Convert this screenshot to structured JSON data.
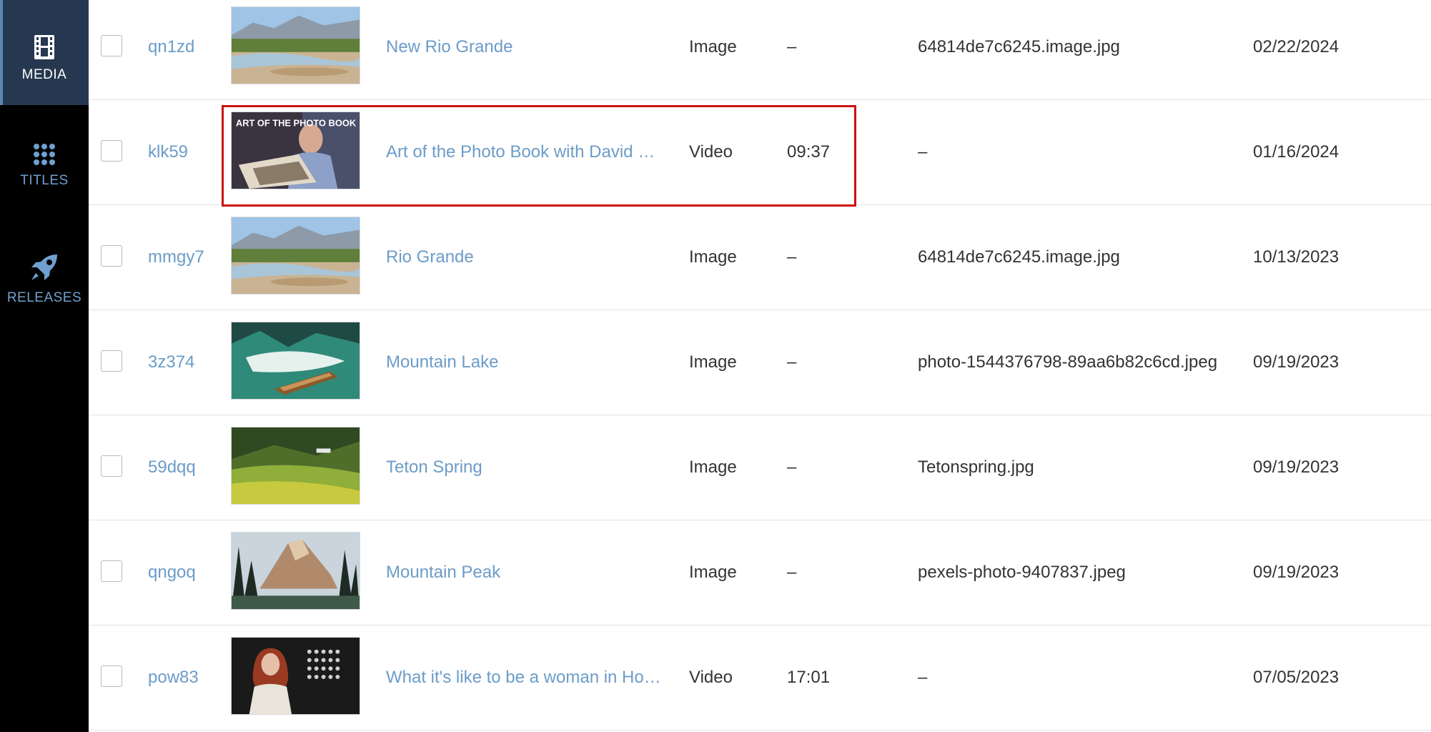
{
  "sidebar": {
    "items": [
      {
        "label": "MEDIA",
        "icon": "film-icon",
        "active": true
      },
      {
        "label": "TITLES",
        "icon": "grid-dots-icon",
        "active": false
      },
      {
        "label": "RELEASES",
        "icon": "rocket-icon",
        "active": false
      }
    ]
  },
  "rows": [
    {
      "id": "qn1zd",
      "thumb": "river-landscape",
      "title": "New Rio Grande",
      "type": "Image",
      "duration": "–",
      "file": "64814de7c6245.image.jpg",
      "date": "02/22/2024"
    },
    {
      "id": "klk59",
      "thumb": "photo-book-video",
      "thumb_text": "ART OF THE PHOTO BOOK",
      "title": "Art of the Photo Book with David C…",
      "type": "Video",
      "duration": "09:37",
      "file": "–",
      "date": "01/16/2024"
    },
    {
      "id": "mmgy7",
      "thumb": "river-landscape",
      "title": "Rio Grande",
      "type": "Image",
      "duration": "–",
      "file": "64814de7c6245.image.jpg",
      "date": "10/13/2023"
    },
    {
      "id": "3z374",
      "thumb": "mountain-lake",
      "title": "Mountain Lake",
      "type": "Image",
      "duration": "–",
      "file": "photo-1544376798-89aa6b82c6cd.jpeg",
      "date": "09/19/2023"
    },
    {
      "id": "59dqq",
      "thumb": "teton-spring",
      "title": "Teton Spring",
      "type": "Image",
      "duration": "–",
      "file": "Tetonspring.jpg",
      "date": "09/19/2023"
    },
    {
      "id": "qngoq",
      "thumb": "mountain-peak",
      "title": "Mountain Peak",
      "type": "Image",
      "duration": "–",
      "file": "pexels-photo-9407837.jpeg",
      "date": "09/19/2023"
    },
    {
      "id": "pow83",
      "thumb": "speaker-stage",
      "title": "What it's like to be a woman in Hol…",
      "type": "Video",
      "duration": "17:01",
      "file": "–",
      "date": "07/05/2023"
    }
  ],
  "highlight": {
    "row": "klk59",
    "color": "#cc1111"
  },
  "colors": {
    "link": "#6c9cc8",
    "sidebar_bg": "#000000",
    "active_bg": "#26384f"
  }
}
